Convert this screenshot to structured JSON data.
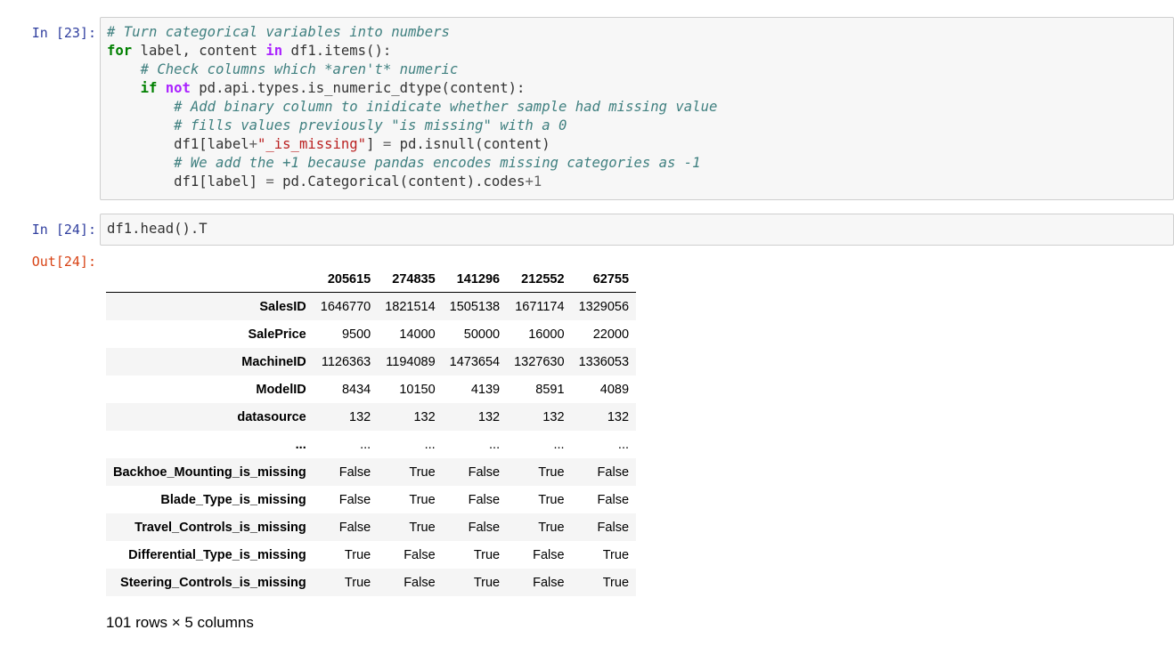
{
  "cells": {
    "in23": {
      "prompt": "In [23]:",
      "code": [
        [
          {
            "t": "cm",
            "v": "# Turn categorical variables into numbers"
          }
        ],
        [
          {
            "t": "kw",
            "v": "for"
          },
          {
            "t": "tx",
            "v": " label, content "
          },
          {
            "t": "ow",
            "v": "in"
          },
          {
            "t": "tx",
            "v": " df1.items():"
          }
        ],
        [
          {
            "t": "tx",
            "v": "    "
          },
          {
            "t": "cm",
            "v": "# Check columns which *aren't* numeric"
          }
        ],
        [
          {
            "t": "tx",
            "v": "    "
          },
          {
            "t": "kw",
            "v": "if"
          },
          {
            "t": "tx",
            "v": " "
          },
          {
            "t": "ow",
            "v": "not"
          },
          {
            "t": "tx",
            "v": " pd.api.types.is_numeric_dtype(content):"
          }
        ],
        [
          {
            "t": "tx",
            "v": "        "
          },
          {
            "t": "cm",
            "v": "# Add binary column to inidicate whether sample had missing value"
          }
        ],
        [
          {
            "t": "tx",
            "v": "        "
          },
          {
            "t": "cm",
            "v": "# fills values previously \"is missing\" with a 0"
          }
        ],
        [
          {
            "t": "tx",
            "v": "        df1[label"
          },
          {
            "t": "op",
            "v": "+"
          },
          {
            "t": "st",
            "v": "\"_is_missing\""
          },
          {
            "t": "tx",
            "v": "] "
          },
          {
            "t": "op",
            "v": "="
          },
          {
            "t": "tx",
            "v": " pd.isnull(content)"
          }
        ],
        [
          {
            "t": "tx",
            "v": "        "
          },
          {
            "t": "cm",
            "v": "# We add the +1 because pandas encodes missing categories as -1"
          }
        ],
        [
          {
            "t": "tx",
            "v": "        df1[label] "
          },
          {
            "t": "op",
            "v": "="
          },
          {
            "t": "tx",
            "v": " pd.Categorical(content).codes"
          },
          {
            "t": "op",
            "v": "+"
          },
          {
            "t": "nu",
            "v": "1"
          }
        ]
      ]
    },
    "in24": {
      "prompt": "In [24]:",
      "code": [
        [
          {
            "t": "tx",
            "v": "df1.head().T"
          }
        ]
      ]
    },
    "out24": {
      "prompt": "Out[24]:",
      "columns": [
        "205615",
        "274835",
        "141296",
        "212552",
        "62755"
      ],
      "rows": [
        {
          "label": "SalesID",
          "values": [
            "1646770",
            "1821514",
            "1505138",
            "1671174",
            "1329056"
          ]
        },
        {
          "label": "SalePrice",
          "values": [
            "9500",
            "14000",
            "50000",
            "16000",
            "22000"
          ]
        },
        {
          "label": "MachineID",
          "values": [
            "1126363",
            "1194089",
            "1473654",
            "1327630",
            "1336053"
          ]
        },
        {
          "label": "ModelID",
          "values": [
            "8434",
            "10150",
            "4139",
            "8591",
            "4089"
          ]
        },
        {
          "label": "datasource",
          "values": [
            "132",
            "132",
            "132",
            "132",
            "132"
          ]
        },
        {
          "label": "...",
          "values": [
            "...",
            "...",
            "...",
            "...",
            "..."
          ]
        },
        {
          "label": "Backhoe_Mounting_is_missing",
          "values": [
            "False",
            "True",
            "False",
            "True",
            "False"
          ]
        },
        {
          "label": "Blade_Type_is_missing",
          "values": [
            "False",
            "True",
            "False",
            "True",
            "False"
          ]
        },
        {
          "label": "Travel_Controls_is_missing",
          "values": [
            "False",
            "True",
            "False",
            "True",
            "False"
          ]
        },
        {
          "label": "Differential_Type_is_missing",
          "values": [
            "True",
            "False",
            "True",
            "False",
            "True"
          ]
        },
        {
          "label": "Steering_Controls_is_missing",
          "values": [
            "True",
            "False",
            "True",
            "False",
            "True"
          ]
        }
      ],
      "shape_text": "101 rows × 5 columns"
    }
  }
}
